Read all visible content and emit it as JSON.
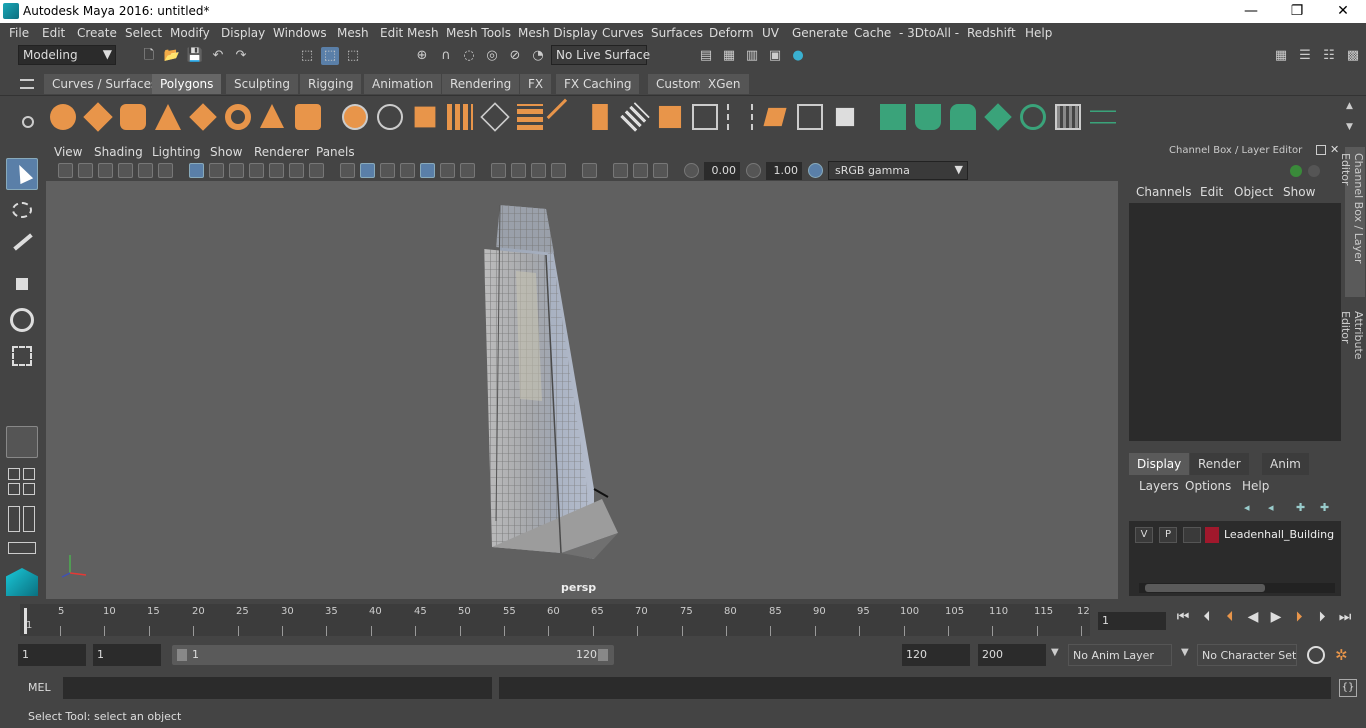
{
  "window": {
    "title": "Autodesk Maya 2016: untitled*",
    "minimize": "—",
    "restore": "❐",
    "close": "✕"
  },
  "menu": [
    "File",
    "Edit",
    "Create",
    "Select",
    "Modify",
    "Display",
    "Windows",
    "Mesh",
    "Edit Mesh",
    "Mesh Tools",
    "Mesh Display",
    "Curves",
    "Surfaces",
    "Deform",
    "UV",
    "Generate",
    "Cache",
    "- 3DtoAll -",
    "Redshift",
    "Help"
  ],
  "status_line": {
    "mode": "Modeling",
    "live_surface": "No Live Surface"
  },
  "shelf_tabs": [
    "Curves / Surfaces",
    "Polygons",
    "Sculpting",
    "Rigging",
    "Animation",
    "Rendering",
    "FX",
    "FX Caching",
    "Custom",
    "XGen"
  ],
  "active_shelf": "Polygons",
  "panel_menu": [
    "View",
    "Shading",
    "Lighting",
    "Show",
    "Renderer",
    "Panels"
  ],
  "panel_toolbar": {
    "exposure": "0.00",
    "gamma": "1.00",
    "color_space": "sRGB gamma"
  },
  "viewport": {
    "camera": "persp"
  },
  "channel_box": {
    "title": "Channel Box / Layer Editor",
    "menus": [
      "Channels",
      "Edit",
      "Object",
      "Show"
    ],
    "layer_tabs": [
      "Display",
      "Render",
      "Anim"
    ],
    "active_layer_tab": "Display",
    "layer_menus": [
      "Layers",
      "Options",
      "Help"
    ],
    "layers": [
      {
        "visible": "V",
        "playback": "P",
        "name": "Leadenhall_Building",
        "color": "#a0182c"
      }
    ]
  },
  "side_tabs": [
    "Channel Box / Layer Editor",
    "Attribute Editor"
  ],
  "time_slider": {
    "ticks": [
      "1",
      "5",
      "10",
      "15",
      "20",
      "25",
      "30",
      "35",
      "40",
      "45",
      "50",
      "55",
      "60",
      "65",
      "70",
      "75",
      "80",
      "85",
      "90",
      "95",
      "100",
      "105",
      "110",
      "115",
      "12"
    ],
    "current_frame": "1"
  },
  "range": {
    "start": "1",
    "playback_start": "1",
    "slider_start": "1",
    "slider_end": "120",
    "playback_end": "120",
    "end": "200",
    "anim_layer": "No Anim Layer",
    "character_set": "No Character Set"
  },
  "mel": {
    "label": "MEL"
  },
  "help_line": "Select Tool: select an object",
  "colors": {
    "accent": "#5a7fa8",
    "shelf_orange": "#e8954a",
    "shelf_green": "#3aa37a"
  }
}
